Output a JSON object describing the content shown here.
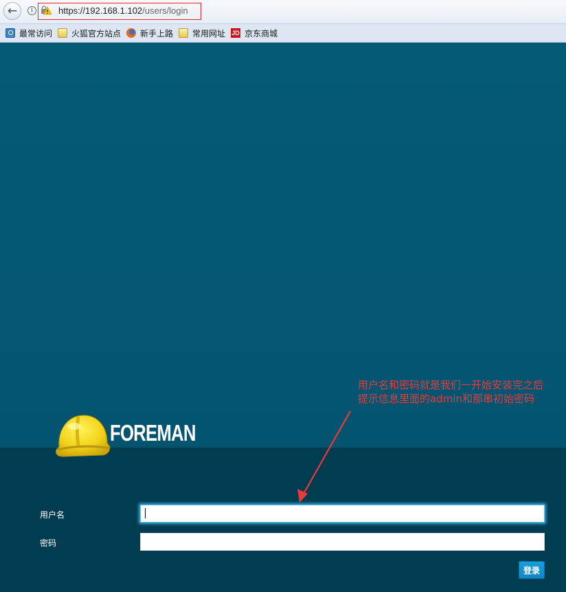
{
  "browser": {
    "url_host": "https://192.168.1.102",
    "url_path": "/users/login",
    "bookmarks": [
      {
        "label": "最常访问",
        "icon": "search-icon"
      },
      {
        "label": "火狐官方站点",
        "icon": "folder-icon"
      },
      {
        "label": "新手上路",
        "icon": "firefox-icon"
      },
      {
        "label": "常用网址",
        "icon": "folder-icon"
      },
      {
        "label": "京东商城",
        "icon": "jd-icon"
      }
    ],
    "jd_icon_text": "JD"
  },
  "page": {
    "brand": "FOREMAN",
    "colors": {
      "background": "#05566f",
      "panel": "#023c51",
      "button": "#0f8fcd",
      "annotation": "#ea3a3a"
    }
  },
  "login": {
    "username_label": "用户名",
    "username_value": "",
    "password_label": "密码",
    "password_value": "",
    "submit_label": "登录"
  },
  "annotation": {
    "line1": "用户名和密码就是我们一开始安装完之后",
    "line2": "提示信息里面的admin和那串初始密码"
  }
}
